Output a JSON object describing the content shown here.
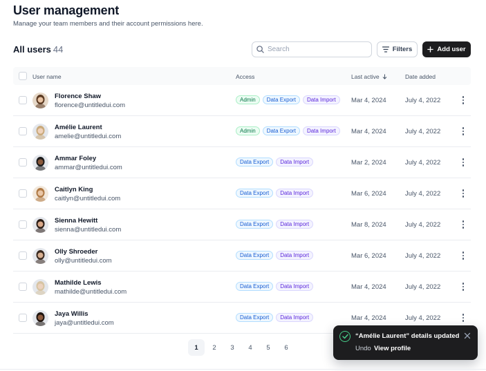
{
  "header": {
    "title": "User management",
    "subtitle": "Manage your team members and their account permissions here."
  },
  "toolbar": {
    "section_title": "All users",
    "user_count": "44",
    "search_placeholder": "Search",
    "filters_label": "Filters",
    "add_user_label": "Add user"
  },
  "table": {
    "columns": [
      "User name",
      "Access",
      "Last active",
      "Date added"
    ],
    "rows": [
      {
        "name": "Florence Shaw",
        "email": "florence@untitledui.com",
        "access": [
          "Admin",
          "Data Export",
          "Data Import"
        ],
        "last_active": "Mar 4, 2024",
        "date_added": "July 4, 2022",
        "avatar_bg": "#e6d8c8",
        "hair": "#5b3a22",
        "skin": "#e8c3a3"
      },
      {
        "name": "Amélie Laurent",
        "email": "amelie@untitledui.com",
        "access": [
          "Admin",
          "Data Export",
          "Data Import"
        ],
        "last_active": "Mar 4, 2024",
        "date_added": "July 4, 2022",
        "avatar_bg": "#e4e7ec",
        "hair": "#c9a97a",
        "skin": "#efd2bb"
      },
      {
        "name": "Ammar Foley",
        "email": "ammar@untitledui.com",
        "access": [
          "Data Export",
          "Data Import"
        ],
        "last_active": "Mar 2, 2024",
        "date_added": "July 4, 2022",
        "avatar_bg": "#e4e7ec",
        "hair": "#1b1b1b",
        "skin": "#8a5a3c"
      },
      {
        "name": "Caitlyn King",
        "email": "caitlyn@untitledui.com",
        "access": [
          "Data Export",
          "Data Import"
        ],
        "last_active": "Mar 6, 2024",
        "date_added": "July 4, 2022",
        "avatar_bg": "#f2e8dc",
        "hair": "#b07a45",
        "skin": "#e9c6a6"
      },
      {
        "name": "Sienna Hewitt",
        "email": "sienna@untitledui.com",
        "access": [
          "Data Export",
          "Data Import"
        ],
        "last_active": "Mar 8, 2024",
        "date_added": "July 4, 2022",
        "avatar_bg": "#e4e7ec",
        "hair": "#2b1e18",
        "skin": "#d9a98a"
      },
      {
        "name": "Olly Shroeder",
        "email": "olly@untitledui.com",
        "access": [
          "Data Export",
          "Data Import"
        ],
        "last_active": "Mar 6, 2024",
        "date_added": "July 4, 2022",
        "avatar_bg": "#e4e7ec",
        "hair": "#3a2a20",
        "skin": "#d8b092"
      },
      {
        "name": "Mathilde Lewis",
        "email": "mathilde@untitledui.com",
        "access": [
          "Data Export",
          "Data Import"
        ],
        "last_active": "Mar 4, 2024",
        "date_added": "July 4, 2022",
        "avatar_bg": "#e4e7ec",
        "hair": "#d7c4a3",
        "skin": "#ecd2bf"
      },
      {
        "name": "Jaya Willis",
        "email": "jaya@untitledui.com",
        "access": [
          "Data Export",
          "Data Import"
        ],
        "last_active": "Mar 4, 2024",
        "date_added": "July 4, 2022",
        "avatar_bg": "#e4e7ec",
        "hair": "#1f1510",
        "skin": "#8c5b3e"
      }
    ]
  },
  "pagination": {
    "pages": [
      "1",
      "2",
      "3",
      "4",
      "5",
      "6"
    ],
    "current": "1"
  },
  "toast": {
    "message": "“Amélie Laurent” details updated",
    "undo_label": "Undo",
    "view_label": "View profile"
  },
  "colors": {
    "primary_button": "#1d1d1f",
    "admin_tag": "#067647",
    "export_tag": "#175cd3",
    "import_tag": "#5925dc",
    "toast_success": "#47cd89"
  }
}
